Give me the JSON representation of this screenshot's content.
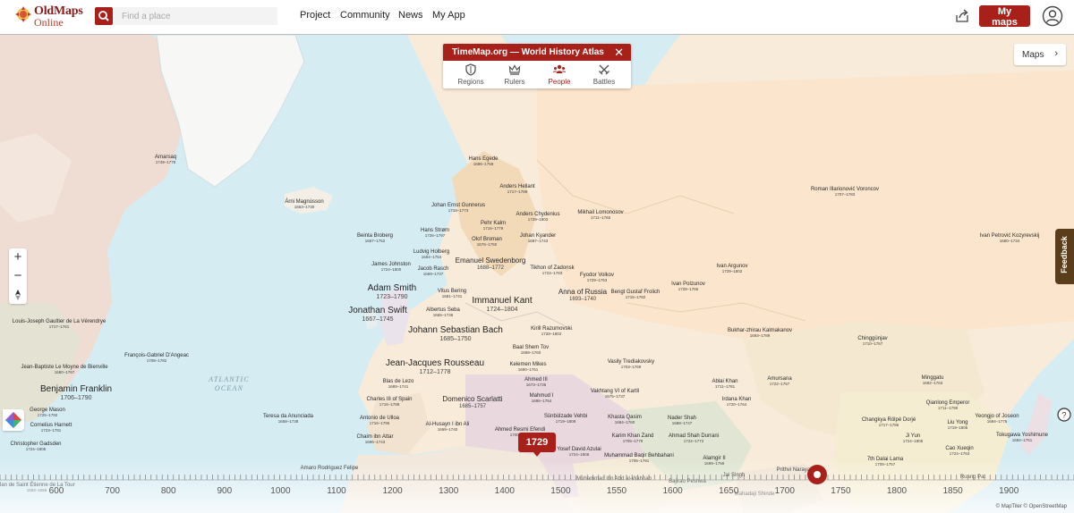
{
  "header": {
    "logo_line1": "OldMaps",
    "logo_line2": "Online",
    "search_placeholder": "Find a place",
    "nav": [
      "Project",
      "Community",
      "News",
      "My App"
    ],
    "my_maps_label": "My maps"
  },
  "panel": {
    "title": "TimeMap.org — World History Atlas",
    "tabs": [
      {
        "label": "Regions",
        "icon": "shield-icon"
      },
      {
        "label": "Rulers",
        "icon": "crown-icon"
      },
      {
        "label": "People",
        "icon": "people-icon",
        "active": true
      },
      {
        "label": "Battles",
        "icon": "crossed-swords-icon"
      }
    ]
  },
  "maps_button": "Maps",
  "feedback_label": "Feedback",
  "ocean_label_line1": "ATLANTIC",
  "ocean_label_line2": "OCEAN",
  "current_year": "1729",
  "timeline_years": [
    "600",
    "700",
    "800",
    "900",
    "1000",
    "1100",
    "1200",
    "1300",
    "1400",
    "1500",
    "1550",
    "1600",
    "1650",
    "1700",
    "1750",
    "1800",
    "1850",
    "1900"
  ],
  "attribution": "© MapTiler © OpenStreetMap",
  "colors": {
    "accent": "#a8201a",
    "feedback": "#5a3e1b",
    "water": "#d6ecf3"
  },
  "people": [
    {
      "name": "Arnarsaq",
      "dates": "1749–1778",
      "size": "s"
    },
    {
      "name": "Árni Magnússon",
      "dates": "1663–1730",
      "size": "s"
    },
    {
      "name": "Hans Egede",
      "dates": "1686–1758",
      "size": "s"
    },
    {
      "name": "Anders Hellant",
      "dates": "1717–1789",
      "size": "s"
    },
    {
      "name": "Johan Ernst Gunnerus",
      "dates": "1718–1773",
      "size": "s"
    },
    {
      "name": "Anders Chydenius",
      "dates": "1729–1803",
      "size": "s"
    },
    {
      "name": "Mikhail Lomonosov",
      "dates": "1711–1765",
      "size": "s"
    },
    {
      "name": "Roman Illarionović Voroncov",
      "dates": "1707–1783",
      "size": "s"
    },
    {
      "name": "Pehr Kalm",
      "dates": "1716–1779",
      "size": "s"
    },
    {
      "name": "Hans Strøm",
      "dates": "1726–1797",
      "size": "s"
    },
    {
      "name": "Johan Kyander",
      "dates": "1687–1743",
      "size": "s"
    },
    {
      "name": "Olof Broman",
      "dates": "1676–1750",
      "size": "s"
    },
    {
      "name": "Beinta Broberg",
      "dates": "1667–1752",
      "size": "s"
    },
    {
      "name": "Ludvig Holberg",
      "dates": "1684–1754",
      "size": "s"
    },
    {
      "name": "Ivan Petrović Kozyrevskij",
      "dates": "1680–1734",
      "size": "s"
    },
    {
      "name": "James Johnston",
      "dates": "1724–1800",
      "size": "s"
    },
    {
      "name": "Jacob Rasch",
      "dates": "1669–1737",
      "size": "s"
    },
    {
      "name": "Emanuel Swedenborg",
      "dates": "1688–1772",
      "size": "m"
    },
    {
      "name": "Tikhon of Zadonsk",
      "dates": "1724–1783",
      "size": "s"
    },
    {
      "name": "Fyodor Volkov",
      "dates": "1729–1763",
      "size": "s"
    },
    {
      "name": "Ivan Argunov",
      "dates": "1729–1802",
      "size": "s"
    },
    {
      "name": "Adam Smith",
      "dates": "1723–1790",
      "size": "l"
    },
    {
      "name": "Vitus Bering",
      "dates": "1681–1741",
      "size": "s"
    },
    {
      "name": "Anna of Russia",
      "dates": "1693–1740",
      "size": "m"
    },
    {
      "name": "Bengt Gustaf Frolich",
      "dates": "1715–1782",
      "size": "s"
    },
    {
      "name": "Ivan Polzunov",
      "dates": "1728–1766",
      "size": "s"
    },
    {
      "name": "Immanuel Kant",
      "dates": "1724–1804",
      "size": "l"
    },
    {
      "name": "Jonathan Swift",
      "dates": "1667–1745",
      "size": "l"
    },
    {
      "name": "Albertus Seba",
      "dates": "1665–1736",
      "size": "s"
    },
    {
      "name": "Louis-Joseph Gaultier de La Vérendrye",
      "dates": "1717–1761",
      "size": "s"
    },
    {
      "name": "Johann Sebastian Bach",
      "dates": "1685–1750",
      "size": "l"
    },
    {
      "name": "Kirill Razumovski",
      "dates": "1728–1803",
      "size": "s"
    },
    {
      "name": "Bukhar-zhirau Kalmakanov",
      "dates": "1693–1789",
      "size": "s"
    },
    {
      "name": "Chinggünjav",
      "dates": "1710–1757",
      "size": "s"
    },
    {
      "name": "Baal Shem Tov",
      "dates": "1698–1760",
      "size": "s"
    },
    {
      "name": "François-Gabriel D'Angeac",
      "dates": "1708–1782",
      "size": "s"
    },
    {
      "name": "Jean-Jacques Rousseau",
      "dates": "1712–1778",
      "size": "l"
    },
    {
      "name": "Vasily Trediakovsky",
      "dates": "1703–1769",
      "size": "s"
    },
    {
      "name": "Jean-Baptiste Le Moyne de Bienville",
      "dates": "1680–1767",
      "size": "s"
    },
    {
      "name": "Kelemen Mikes",
      "dates": "1690–1761",
      "size": "s"
    },
    {
      "name": "Ahmed III",
      "dates": "1673–1736",
      "size": "s"
    },
    {
      "name": "Ablai Khan",
      "dates": "1711–1781",
      "size": "s"
    },
    {
      "name": "Amursana",
      "dates": "1722–1757",
      "size": "s"
    },
    {
      "name": "Minggatu",
      "dates": "1692–1763",
      "size": "s"
    },
    {
      "name": "Blas de Lezo",
      "dates": "1689–1741",
      "size": "s"
    },
    {
      "name": "Benjamin Franklin",
      "dates": "1706–1790",
      "size": "l"
    },
    {
      "name": "Domenico Scarlatti",
      "dates": "1685–1757",
      "size": "m"
    },
    {
      "name": "Vakhtang VI of Kartli",
      "dates": "1675–1737",
      "size": "s"
    },
    {
      "name": "Mahmud I",
      "dates": "1696–1754",
      "size": "s"
    },
    {
      "name": "Irdana Khan",
      "dates": "1720–1764",
      "size": "s"
    },
    {
      "name": "Qianlong Emperor",
      "dates": "1711–1799",
      "size": "s"
    },
    {
      "name": "Charles III of Spain",
      "dates": "1716–1788",
      "size": "s"
    },
    {
      "name": "George Mason",
      "dates": "1725–1792",
      "size": "s"
    },
    {
      "name": "Teresa da Anunciada",
      "dates": "1658–1738",
      "size": "s"
    },
    {
      "name": "Antonio de Ulloa",
      "dates": "1716–1795",
      "size": "s"
    },
    {
      "name": "Sünbülzade Vehbi",
      "dates": "1719–1809",
      "size": "s"
    },
    {
      "name": "Khasta Qasim",
      "dates": "1684–1760",
      "size": "s"
    },
    {
      "name": "Nader Shah",
      "dates": "1688–1747",
      "size": "s"
    },
    {
      "name": "Changkya Rölpé Dorjé",
      "dates": "1717–1786",
      "size": "s"
    },
    {
      "name": "Liu Yong",
      "dates": "1719–1805",
      "size": "s"
    },
    {
      "name": "Yeongjo of Joseon",
      "dates": "1694–1776",
      "size": "s"
    },
    {
      "name": "Cornelius Harnett",
      "dates": "1723–1781",
      "size": "s"
    },
    {
      "name": "Al-Husayn I ibn Ali",
      "dates": "1669–1740",
      "size": "s"
    },
    {
      "name": "Karim Khan Zand",
      "dates": "1705–1779",
      "size": "s"
    },
    {
      "name": "Ji Yun",
      "dates": "1724–1805",
      "size": "s"
    },
    {
      "name": "Chaim ibn Attar",
      "dates": "1696–1743",
      "size": "s"
    },
    {
      "name": "Ahmed Resmi Efendi",
      "dates": "1700–1783",
      "size": "s"
    },
    {
      "name": "Ahmad Shah Durrani",
      "dates": "1722–1772",
      "size": "s"
    },
    {
      "name": "Tokugawa Yoshimune",
      "dates": "1684–1751",
      "size": "s"
    },
    {
      "name": "Christopher Gadsden",
      "dates": "1724–1805",
      "size": "s"
    },
    {
      "name": "Yosef David Azulai",
      "dates": "1724–1806",
      "size": "s"
    },
    {
      "name": "Cao Xueqin",
      "dates": "1724–1763",
      "size": "s"
    },
    {
      "name": "Muhammad Baqir Behbahani",
      "dates": "1706–1791",
      "size": "s"
    },
    {
      "name": "Alamgir II",
      "dates": "1699–1759",
      "size": "s"
    },
    {
      "name": "7th Dalai Lama",
      "dates": "1708–1757",
      "size": "s"
    },
    {
      "name": "Amaro Rodriguez Felipe",
      "dates": "",
      "size": "s"
    },
    {
      "name": "Prithvi Narayan",
      "dates": "",
      "size": "s"
    },
    {
      "name": "Ruang Pat",
      "dates": "",
      "size": "s"
    },
    {
      "name": "Jai Singh",
      "dates": "",
      "size": "s"
    },
    {
      "name": "Jan de Saint Étienne de La Tour",
      "dates": "1593–1656",
      "size": "s"
    },
    {
      "name": "Muhammad ibn Abd al-Wahhab",
      "dates": "",
      "size": "s"
    },
    {
      "name": "Bajirao Peshwa",
      "dates": "",
      "size": "s"
    },
    {
      "name": "Mahadaji Shinde",
      "dates": "",
      "size": "s"
    }
  ]
}
